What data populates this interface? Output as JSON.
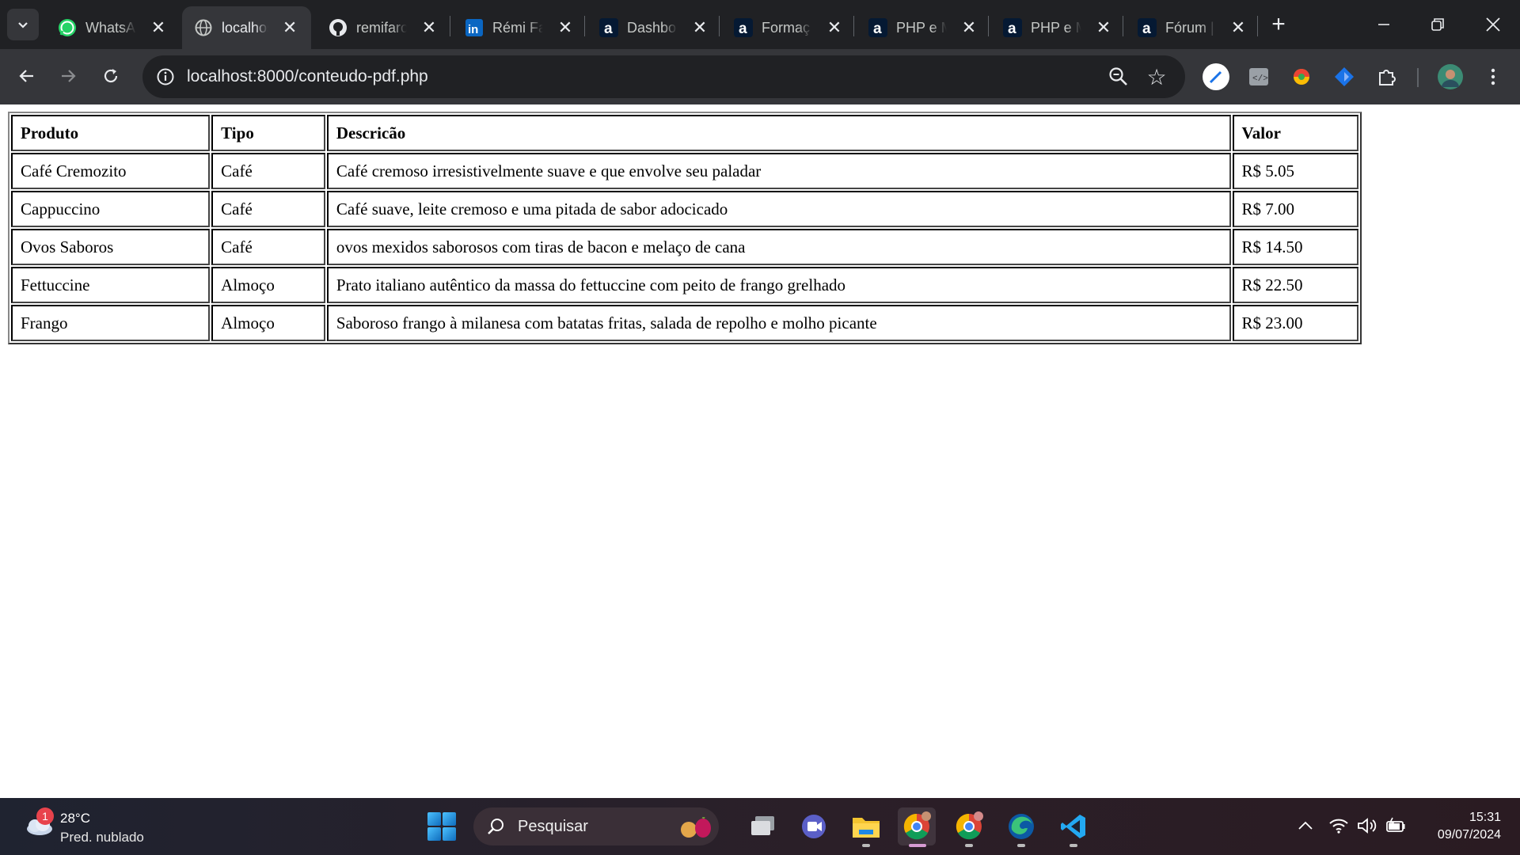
{
  "browser": {
    "tabs": [
      {
        "title": "WhatsApp",
        "icon": "whatsapp-icon",
        "active": false
      },
      {
        "title": "localhost",
        "icon": "globe-icon",
        "active": true
      },
      {
        "title": "remifaro",
        "icon": "github-icon",
        "active": false
      },
      {
        "title": "Rémi Fa",
        "icon": "linkedin-icon",
        "active": false
      },
      {
        "title": "Dashbo",
        "icon": "alura-icon",
        "active": false
      },
      {
        "title": "Formaç",
        "icon": "alura-icon",
        "active": false
      },
      {
        "title": "PHP e M",
        "icon": "alura-icon",
        "active": false
      },
      {
        "title": "PHP e M",
        "icon": "alura-icon",
        "active": false
      },
      {
        "title": "Fórum |",
        "icon": "alura-icon",
        "active": false
      }
    ],
    "url": "localhost:8000/conteudo-pdf.php",
    "colors": {
      "frame": "#202124",
      "toolbar": "#35363a"
    }
  },
  "table": {
    "headers": {
      "produto": "Produto",
      "tipo": "Tipo",
      "descricao": "Descricão",
      "valor": "Valor"
    },
    "rows": [
      {
        "produto": "Café Cremozito",
        "tipo": "Café",
        "descricao": "Café cremoso irresistivelmente suave e que envolve seu paladar",
        "valor": "R$ 5.05"
      },
      {
        "produto": "Cappuccino",
        "tipo": "Café",
        "descricao": "Café suave, leite cremoso e uma pitada de sabor adocicado",
        "valor": "R$ 7.00"
      },
      {
        "produto": "Ovos Saboros",
        "tipo": "Café",
        "descricao": "ovos mexidos saborosos com tiras de bacon e melaço de cana",
        "valor": "R$ 14.50"
      },
      {
        "produto": "Fettuccine",
        "tipo": "Almoço",
        "descricao": "Prato italiano autêntico da massa do fettuccine com peito de frango grelhado",
        "valor": "R$ 22.50"
      },
      {
        "produto": "Frango",
        "tipo": "Almoço",
        "descricao": "Saboroso frango à milanesa com batatas fritas, salada de repolho e molho picante",
        "valor": "R$ 23.00"
      }
    ]
  },
  "taskbar": {
    "weather": {
      "temp": "28°C",
      "condition": "Pred. nublado",
      "badge": "1"
    },
    "search_placeholder": "Pesquisar",
    "time": "15:31",
    "date": "09/07/2024"
  }
}
